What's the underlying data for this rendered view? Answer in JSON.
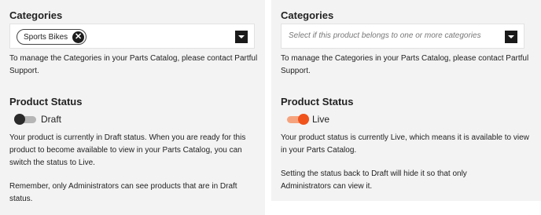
{
  "left": {
    "categories_heading": "Categories",
    "chip_label": "Sports Bikes",
    "chip_remove_glyph": "✕",
    "manage_text": "To manage the Categories in your Parts Catalog, please contact Partful Support.",
    "status_heading": "Product Status",
    "toggle_state": "off",
    "toggle_label": "Draft",
    "status_para1": "Your product is currently in Draft status.  When you are ready for this product to become available to view in your Parts Catalog, you can switch the status to Live.",
    "status_para2": "Remember, only Administrators can see products that are in Draft status."
  },
  "right": {
    "categories_heading": "Categories",
    "select_placeholder": "Select if this product belongs to one or more categories",
    "manage_text": "To manage the Categories in your Parts Catalog, please contact Partful Support.",
    "status_heading": "Product Status",
    "toggle_state": "on",
    "toggle_label": "Live",
    "status_para1": "Your product status is currently Live, which means it is available to view in your Parts Catalog.",
    "status_para2": "Setting the status back to Draft will hide it so that only Administrators can view it."
  },
  "colors": {
    "panel_bg": "#f3f3f3",
    "toggle_on_track": "#f6a37d",
    "toggle_on_knob": "#f0531c",
    "toggle_off_track": "#b5b5b5",
    "toggle_off_knob": "#2a2a2a"
  },
  "icons": {
    "chip_remove": "close-circle-icon",
    "dropdown": "caret-down-icon"
  }
}
